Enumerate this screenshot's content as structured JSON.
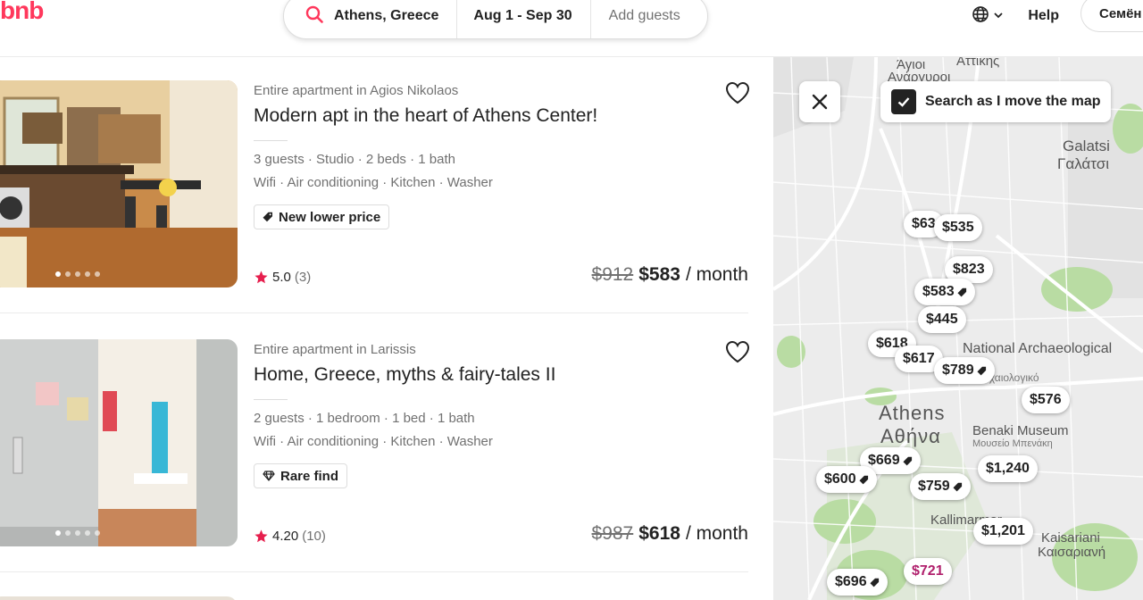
{
  "header": {
    "logo": "bnb",
    "search": {
      "location": "Athens, Greece",
      "dates": "Aug 1 - Sep 30",
      "guests_placeholder": "Add guests"
    },
    "help": "Help",
    "user": "Семён"
  },
  "listings": [
    {
      "type": "Entire apartment in Agios Nikolaos",
      "title": "Modern apt in the heart of Athens Center!",
      "info": "3 guests · Studio · 2 beds · 1 bath",
      "amenities": "Wifi · Air conditioning · Kitchen · Washer",
      "badge": "New lower price",
      "rating": "5.0",
      "reviews": "(3)",
      "old_price": "$912",
      "price": "$583",
      "period": "/ month"
    },
    {
      "type": "Entire apartment in Larissis",
      "title": "Home, Greece, myths & fairy-tales II",
      "info": "2 guests · 1 bedroom · 1 bed · 1 bath",
      "amenities": "Wifi · Air conditioning · Kitchen · Washer",
      "badge": "Rare find",
      "rating": "4.20",
      "reviews": "(10)",
      "old_price": "$987",
      "price": "$618",
      "period": "/ month"
    }
  ],
  "map": {
    "toggle_label": "Search as I move the map",
    "pins": [
      "$63",
      "$535",
      "$823",
      "$583",
      "$445",
      "$618",
      "$617",
      "$789",
      "$576",
      "$669",
      "$600",
      "$759",
      "$1,240",
      "$1,201",
      "$696",
      "$721"
    ],
    "labels": {
      "galatsi": "Galatsi",
      "galatsi_gr": "Γαλάτσι",
      "athens": "Athens",
      "athens_gr": "Αθήνα",
      "museum": "National Archaeological",
      "museum_gr": "Αρχαιολογικό",
      "benaki": "Benaki Museum",
      "benaki_gr": "Μουσείο Μπενάκη",
      "kaisariani": "Kaisariani",
      "kaisariani_gr": "Καισαριανή",
      "kallimarmaro": "Kallimarmar",
      "agioi": "Άγιοι",
      "attikis": "Αττικής",
      "anargyroi": "Ανάργυροι"
    }
  }
}
